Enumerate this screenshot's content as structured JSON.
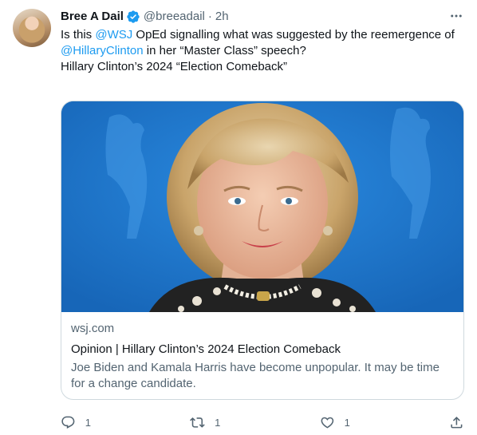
{
  "tweet": {
    "author_name": "Bree A Dail",
    "handle": "@breeadail",
    "separator": "·",
    "time": "2h",
    "verified": true,
    "text": {
      "line1_before": "Is this ",
      "mention1": "@WSJ",
      "line1_after": " OpEd signalling what was suggested by the reemergence of ",
      "mention2": "@HillaryClinton",
      "line2_after": " in her “Master Class” speech?",
      "paragraph2": "Hillary Clinton’s 2024 “Election Comeback”"
    }
  },
  "card": {
    "domain": "wsj.com",
    "title": "Opinion | Hillary Clinton’s 2024 Election Comeback",
    "description": "Joe Biden and Kamala Harris have become unpopular. It may be time for a change candidate."
  },
  "actions": {
    "reply_count": "1",
    "retweet_count": "1",
    "like_count": "1"
  },
  "colors": {
    "accent": "#1d9bf0",
    "secondary_text": "#536471",
    "primary_text": "#0f1419",
    "border": "#cfd9de",
    "image_background": "#1f7fd6"
  }
}
